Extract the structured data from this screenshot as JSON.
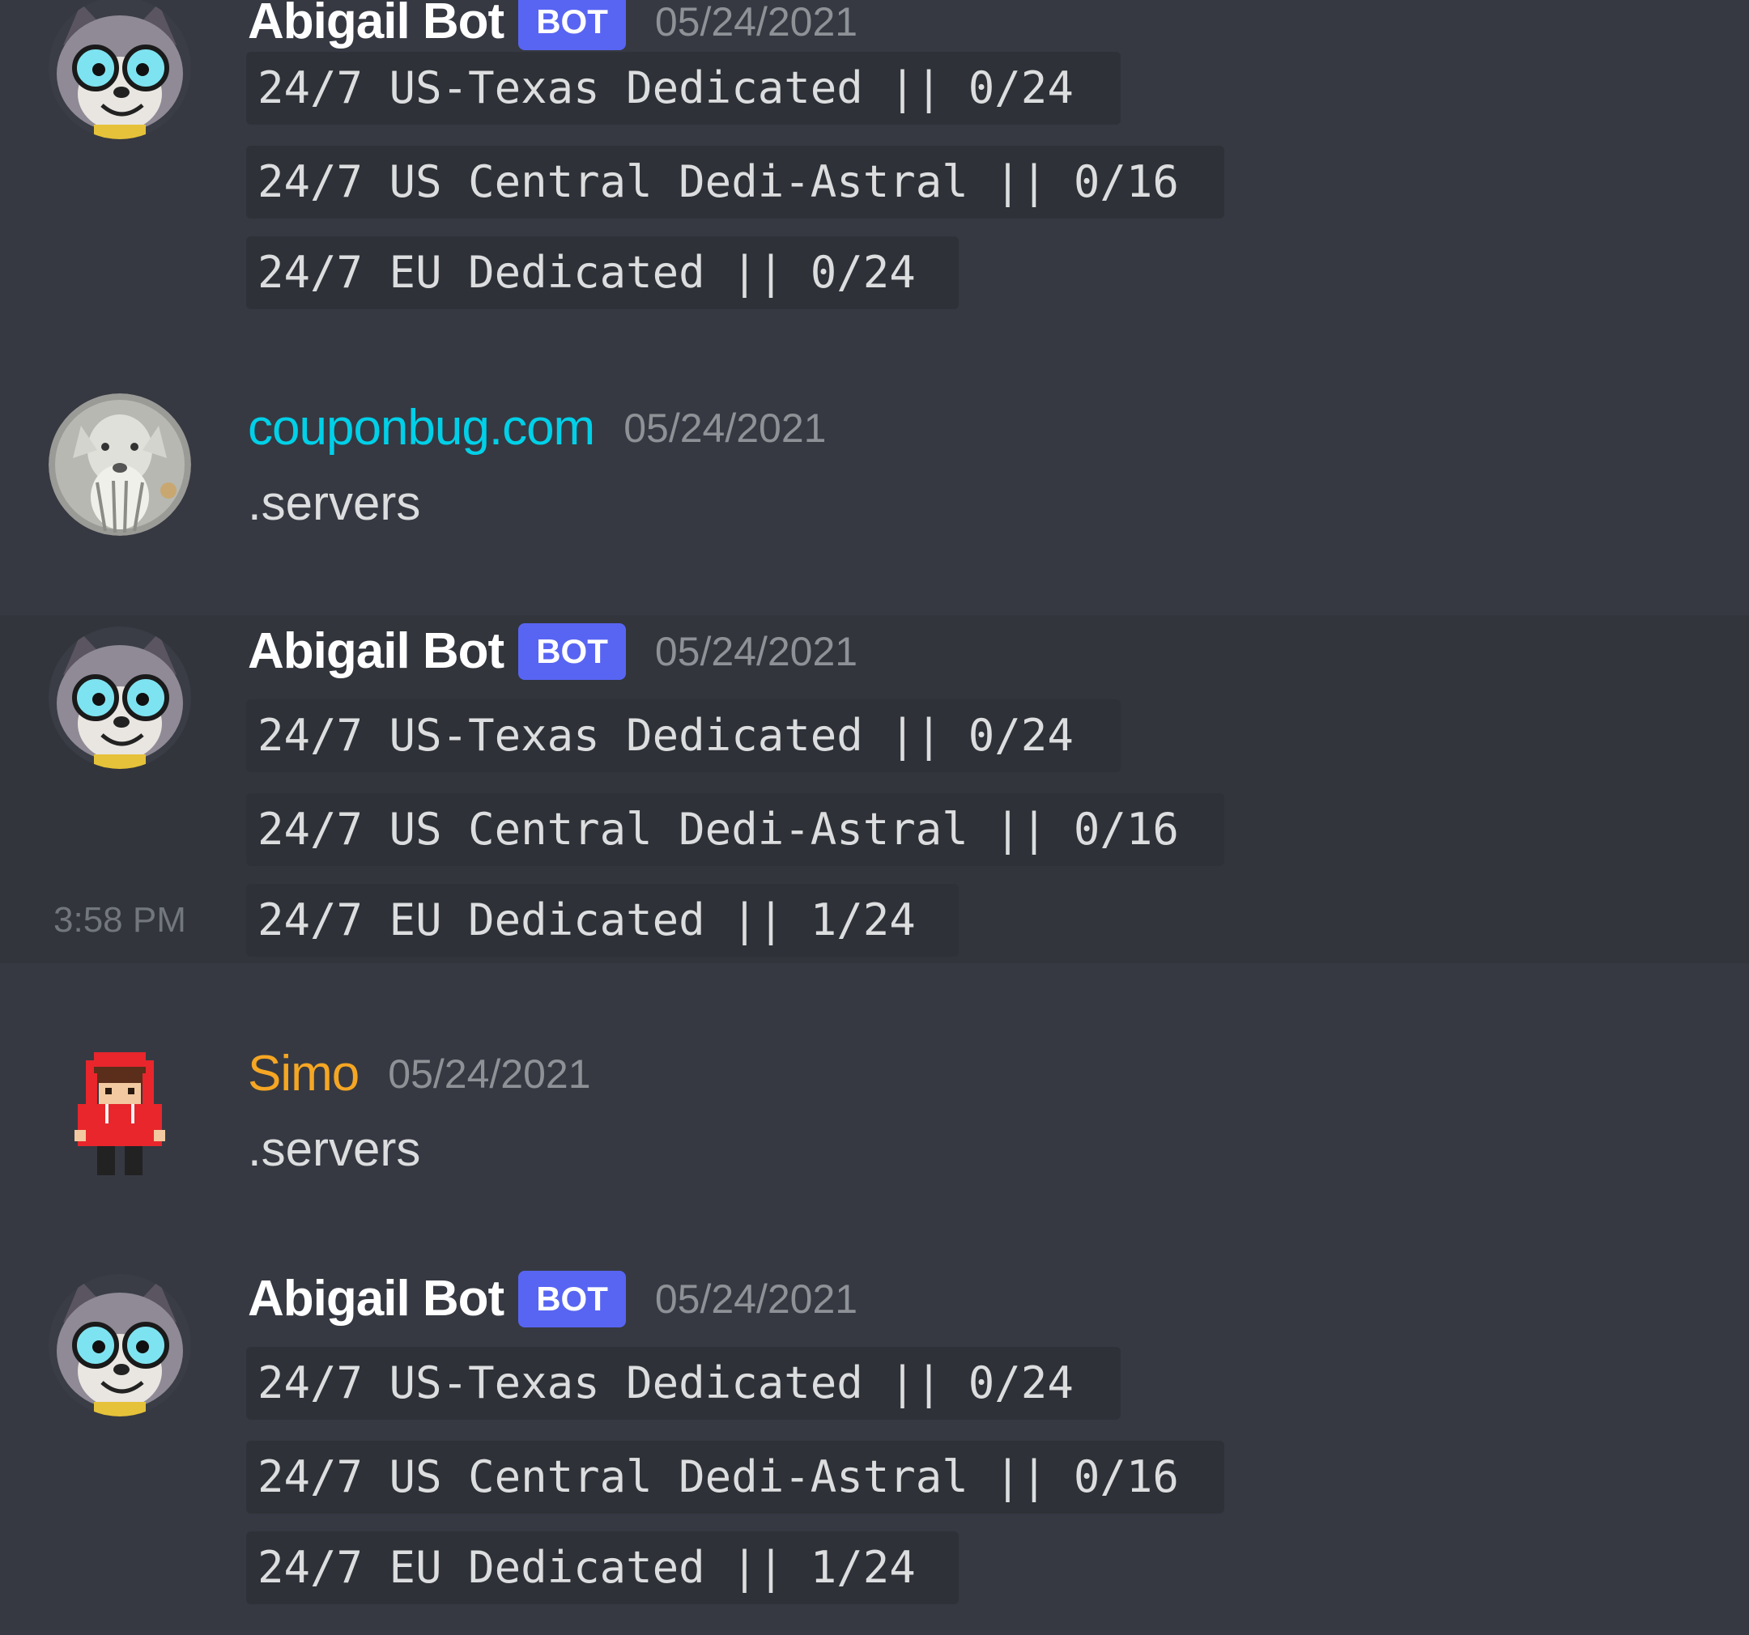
{
  "messages": [
    {
      "author": "Abigail Bot",
      "badge": "BOT",
      "timestamp": "05/24/2021",
      "lines": [
        "24/7 US-Texas Dedicated || 0/24",
        "24/7 US Central Dedi-Astral || 0/16",
        "24/7 EU Dedicated || 0/24"
      ]
    },
    {
      "author": "couponbug.com",
      "timestamp": "05/24/2021",
      "text": ".servers"
    },
    {
      "author": "Abigail Bot",
      "badge": "BOT",
      "timestamp": "05/24/2021",
      "hover_time": "3:58 PM",
      "lines": [
        "24/7 US-Texas Dedicated || 0/24",
        "24/7 US Central Dedi-Astral || 0/16",
        "24/7 EU Dedicated || 1/24"
      ]
    },
    {
      "author": "Simo",
      "timestamp": "05/24/2021",
      "text": ".servers"
    },
    {
      "author": "Abigail Bot",
      "badge": "BOT",
      "timestamp": "05/24/2021",
      "lines": [
        "24/7 US-Texas Dedicated || 0/24",
        "24/7 US Central Dedi-Astral || 0/16",
        "24/7 EU Dedicated || 1/24"
      ]
    }
  ],
  "colors": {
    "background": "#363942",
    "bot_badge": "#5865f2",
    "couponbug_name": "#00d0e8",
    "simo_name": "#f5a623"
  },
  "icons": {
    "bot_avatar": "raccoon-avatar-icon",
    "couponbug_avatar": "animal-photo-avatar-icon",
    "simo_avatar": "pixel-character-avatar-icon"
  }
}
